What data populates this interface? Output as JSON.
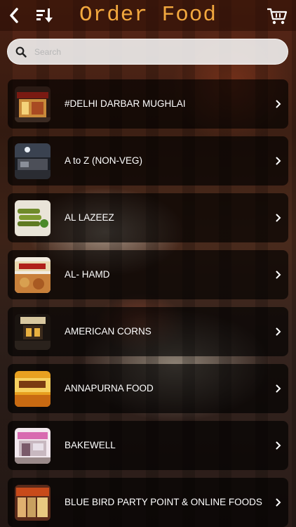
{
  "header": {
    "title": "Order Food",
    "back_icon": "chevron-left-icon",
    "sort_icon": "sort-list-down-icon",
    "cart_icon": "shopping-cart-icon",
    "title_color": "#f2a83e"
  },
  "search": {
    "placeholder": "Search",
    "value": "",
    "icon": "search-icon"
  },
  "restaurants": [
    {
      "name": "#DELHI DARBAR MUGHLAI"
    },
    {
      "name": "A to Z (NON-VEG)"
    },
    {
      "name": "AL LAZEEZ"
    },
    {
      "name": "AL- HAMD"
    },
    {
      "name": "AMERICAN CORNS"
    },
    {
      "name": "ANNAPURNA FOOD"
    },
    {
      "name": "BAKEWELL"
    },
    {
      "name": "BLUE BIRD PARTY POINT & ONLINE FOODS"
    }
  ]
}
